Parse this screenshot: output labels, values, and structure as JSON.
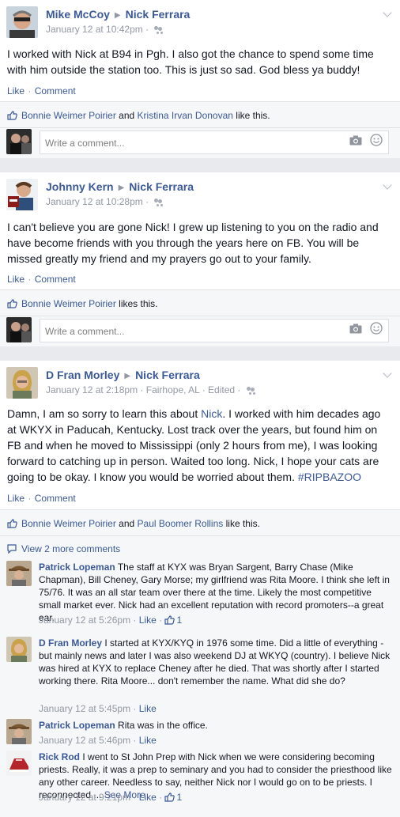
{
  "posts": [
    {
      "author": "Mike McCoy",
      "target": "Nick Ferrara",
      "timestamp": "January 12 at 10:42pm",
      "location": "",
      "edited": "",
      "text": "I worked with Nick at B94 in Pgh. I also got the chance to spend some time with him outside the station too. This is just so sad. God bless ya buddy!",
      "like_label": "Like",
      "comment_label": "Comment",
      "likers": [
        "Bonnie Weimer Poirier",
        "Kristina Irvan Donovan"
      ],
      "likes_connector": "and",
      "likes_suffix": "like this.",
      "comment_placeholder": "Write a comment..."
    },
    {
      "author": "Johnny Kern",
      "target": "Nick Ferrara",
      "timestamp": "January 12 at 10:28pm",
      "text": "I can't believe you are gone Nick! I grew up listening to you on the radio and have become friends with you through the years here on FB. You will be missed greatly my friend and my prayers go out to your family.",
      "like_label": "Like",
      "comment_label": "Comment",
      "likers": [
        "Bonnie Weimer Poirier"
      ],
      "likes_suffix": "likes this.",
      "comment_placeholder": "Write a comment..."
    },
    {
      "author": "D Fran Morley",
      "target": "Nick Ferrara",
      "timestamp": "January 12 at 2:18pm",
      "location": "Fairhope, AL",
      "edited": "Edited",
      "text_before": "Damn, I am so sorry to learn this about ",
      "text_mention": "Nick",
      "text_after": ". I worked with him decades ago at WKYX in Paducah, Kentucky. Lost track over the years, but found him on FB and when he moved to Mississippi (only 2 hours from me), I was looking forward to catching up in person. Waited too long. Nick, I hope your cats are going to be okay. I know you would be worried about them. ",
      "hashtag": "#RIPBAZOO",
      "like_label": "Like",
      "comment_label": "Comment",
      "likers": [
        "Bonnie Weimer Poirier",
        "Paul Boomer Rollins"
      ],
      "likes_connector": "and",
      "likes_suffix": "like this.",
      "view_more": "View 2 more comments",
      "comments": [
        {
          "author": "Patrick Lopeman",
          "text": "The staff at KYX was Bryan Sargent, Barry Chase (Mike Chapman), Bill Cheney, Gary Morse; my girlfriend was Rita Moore. I think she left in 75/76. It was an all star team over there at the time. Likely the most competitive small market ever. Nick had an excellent reputation with record promoters--a great ear.",
          "time": "January 12 at 5:26pm",
          "like": "Like",
          "like_count": "1"
        },
        {
          "author": "D Fran Morley",
          "text": "I started at KYX/KYQ in 1976 some time. Did a little of everything - but mainly news and later I was also weekend DJ at WKYQ (country). I believe Nick was hired at KYX to replace Cheney after he died. That was shortly after I started working there. Rita Moore... don't remember the name. What did she do?",
          "time": "January 12 at 5:45pm",
          "like": "Like"
        },
        {
          "author": "Patrick Lopeman",
          "text": "Rita was in the office.",
          "time": "January 12 at 5:46pm",
          "like": "Like"
        },
        {
          "author": "Rick Rod",
          "text": "I went to St John Prep with Nick when we were considering becoming priests. Really, it was a prep to seminary and you had to consider the priesthood like any other career. Needless to say, neither Nick nor I would go on to be priests. I reconnected ... ",
          "see_more": "See More",
          "time": "January 12 at 9:21pm",
          "like": "Like",
          "like_count": "1"
        }
      ]
    }
  ],
  "separator": " · ",
  "colors": {
    "link": "#3b5998",
    "meta": "#9197a3",
    "background": "#e9eaed",
    "ufi": "#f6f7f8"
  }
}
